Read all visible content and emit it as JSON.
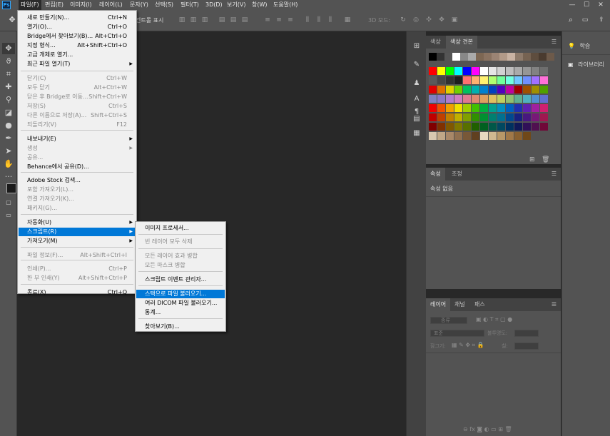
{
  "menubar": {
    "logo": "Ps",
    "items": [
      "파일(F)",
      "편집(E)",
      "이미지(I)",
      "레이어(L)",
      "문자(Y)",
      "선택(S)",
      "필터(T)",
      "3D(D)",
      "보기(V)",
      "창(W)",
      "도움말(H)"
    ],
    "window_controls": [
      "—",
      "☐",
      "✕"
    ]
  },
  "optionsbar": {
    "transform_controls_label": "컨트롤 표시",
    "mode_3d": "3D 모드:"
  },
  "file_menu": {
    "items": [
      {
        "label": "새로 만들기(N)...",
        "shortcut": "Ctrl+N",
        "disabled": false
      },
      {
        "label": "열기(O)...",
        "shortcut": "Ctrl+O",
        "disabled": false
      },
      {
        "label": "Bridge에서 찾아보기(B)...",
        "shortcut": "Alt+Ctrl+O",
        "disabled": false
      },
      {
        "label": "지정 형식...",
        "shortcut": "Alt+Shift+Ctrl+O",
        "disabled": false
      },
      {
        "label": "고급 개체로 열기...",
        "shortcut": "",
        "disabled": false
      },
      {
        "label": "최근 파일 열기(T)",
        "shortcut": "",
        "disabled": false,
        "submenu": true
      },
      {
        "label": "닫기(C)",
        "shortcut": "Ctrl+W",
        "disabled": true
      },
      {
        "label": "모두 닫기",
        "shortcut": "Alt+Ctrl+W",
        "disabled": true
      },
      {
        "label": "닫은 후 Bridge로 이동...",
        "shortcut": "Shift+Ctrl+W",
        "disabled": true
      },
      {
        "label": "저장(S)",
        "shortcut": "Ctrl+S",
        "disabled": true
      },
      {
        "label": "다른 이름으로 저장(A)...",
        "shortcut": "Shift+Ctrl+S",
        "disabled": true
      },
      {
        "label": "되돌리기(V)",
        "shortcut": "F12",
        "disabled": true
      },
      {
        "label": "내보내기(E)",
        "shortcut": "",
        "disabled": false,
        "submenu": true
      },
      {
        "label": "생성",
        "shortcut": "",
        "disabled": true,
        "submenu": true
      },
      {
        "label": "공유...",
        "shortcut": "",
        "disabled": true
      },
      {
        "label": "Behance에서 공유(D)...",
        "shortcut": "",
        "disabled": false
      },
      {
        "label": "Adobe Stock 검색...",
        "shortcut": "",
        "disabled": false
      },
      {
        "label": "포함 가져오기(L)...",
        "shortcut": "",
        "disabled": true
      },
      {
        "label": "연결 가져오기(K)...",
        "shortcut": "",
        "disabled": true
      },
      {
        "label": "패키지(G)...",
        "shortcut": "",
        "disabled": true
      },
      {
        "label": "자동화(U)",
        "shortcut": "",
        "disabled": false,
        "submenu": true
      },
      {
        "label": "스크립트(R)",
        "shortcut": "",
        "disabled": false,
        "submenu": true,
        "highlighted": true
      },
      {
        "label": "가져오기(M)",
        "shortcut": "",
        "disabled": false,
        "submenu": true
      },
      {
        "label": "파일 정보(F)...",
        "shortcut": "Alt+Shift+Ctrl+I",
        "disabled": true
      },
      {
        "label": "인쇄(P)...",
        "shortcut": "Ctrl+P",
        "disabled": true
      },
      {
        "label": "한 부 인쇄(Y)",
        "shortcut": "Alt+Shift+Ctrl+P",
        "disabled": true
      },
      {
        "label": "종료(X)",
        "shortcut": "Ctrl+Q",
        "disabled": false
      }
    ]
  },
  "scripts_submenu": {
    "items": [
      {
        "label": "이미지 프로세서...",
        "disabled": false
      },
      {
        "label": "빈 레이어 모두 삭제",
        "disabled": true
      },
      {
        "label": "모든 레이어 효과 병합",
        "disabled": true
      },
      {
        "label": "모든 마스크 병합",
        "disabled": true
      },
      {
        "label": "스크립트 이벤트 관리자...",
        "disabled": false
      },
      {
        "label": "스택으로 파일 불러오기...",
        "disabled": false,
        "highlighted": true
      },
      {
        "label": "여러 DICOM 파일 불러오기...",
        "disabled": false
      },
      {
        "label": "통계...",
        "disabled": false
      },
      {
        "label": "찾아보기(B)...",
        "disabled": false
      }
    ]
  },
  "swatches_panel": {
    "tabs": [
      "색상",
      "색상 견본"
    ],
    "top_row": [
      "#000000",
      "#333333",
      "#555555",
      "#ffffff",
      "#888888",
      "#aaaaaa",
      "#7d6753",
      "#8a7361",
      "#9b8474",
      "#b29a88",
      "#c9b3a3",
      "#8e7b6b",
      "#766352",
      "#5e4d3e",
      "#4a3b2f",
      "#6d5a4a"
    ],
    "rows": [
      [
        "#ff0000",
        "#ffff00",
        "#00ff00",
        "#00ffff",
        "#0000ff",
        "#ff00ff",
        "#ffffff",
        "#e6e6e6",
        "#d2d2d2",
        "#bebebe",
        "#aaaaaa",
        "#969696",
        "#828282",
        "#6e6e6e"
      ],
      [
        "#5a5a5a",
        "#464646",
        "#323232",
        "#1e1e1e",
        "#ff7070",
        "#ffb070",
        "#fff070",
        "#b0ff70",
        "#70ff9a",
        "#70ffe0",
        "#70c8ff",
        "#7090ff",
        "#a070ff",
        "#ff70d8"
      ],
      [
        "#e00000",
        "#e07000",
        "#e0d000",
        "#70d000",
        "#00c060",
        "#00b0b0",
        "#0080d0",
        "#0040c0",
        "#5000c0",
        "#c000a0",
        "#a00000",
        "#a05000",
        "#a09000",
        "#50a000"
      ],
      [
        "#8080c0",
        "#8a78c8",
        "#b07cd0",
        "#d07cc0",
        "#e07a90",
        "#e08870",
        "#e0a060",
        "#e0c060",
        "#c0d060",
        "#90c070",
        "#60b090",
        "#50b0c0",
        "#5090d0",
        "#6070d0"
      ],
      [
        "#f00000",
        "#f05000",
        "#f0a000",
        "#f0e000",
        "#a0d000",
        "#40c000",
        "#00b040",
        "#00a090",
        "#0090c0",
        "#0060c0",
        "#2030b0",
        "#6020b0",
        "#a020a0",
        "#d02070"
      ],
      [
        "#c00000",
        "#c04000",
        "#c08000",
        "#c0b000",
        "#80a000",
        "#309000",
        "#009030",
        "#008070",
        "#007090",
        "#004890",
        "#182080",
        "#481880",
        "#781878",
        "#a01850"
      ],
      [
        "#800000",
        "#803000",
        "#805800",
        "#807800",
        "#587000",
        "#206000",
        "#006020",
        "#005848",
        "#004860",
        "#003060",
        "#101858",
        "#301058",
        "#501050",
        "#700838"
      ],
      [
        "#d8c8b0",
        "#c0a888",
        "#a88868",
        "#907050",
        "#785838",
        "#604020",
        "#e8d8c0",
        "#d0b890",
        "#b89868",
        "#a07848",
        "#886030",
        "#704818"
      ]
    ]
  },
  "properties_panel": {
    "tabs": [
      "속성",
      "조정"
    ],
    "empty_text": "속성 없음"
  },
  "layers_panel": {
    "tabs": [
      "레이어",
      "채널",
      "패스"
    ],
    "filter_label": "종류",
    "blend_mode": "표준",
    "opacity_label": "불투명도:",
    "lock_label": "잠그기:",
    "fill_label": "칠:"
  },
  "far_right": {
    "items": [
      "학습",
      "라이브러리"
    ]
  }
}
